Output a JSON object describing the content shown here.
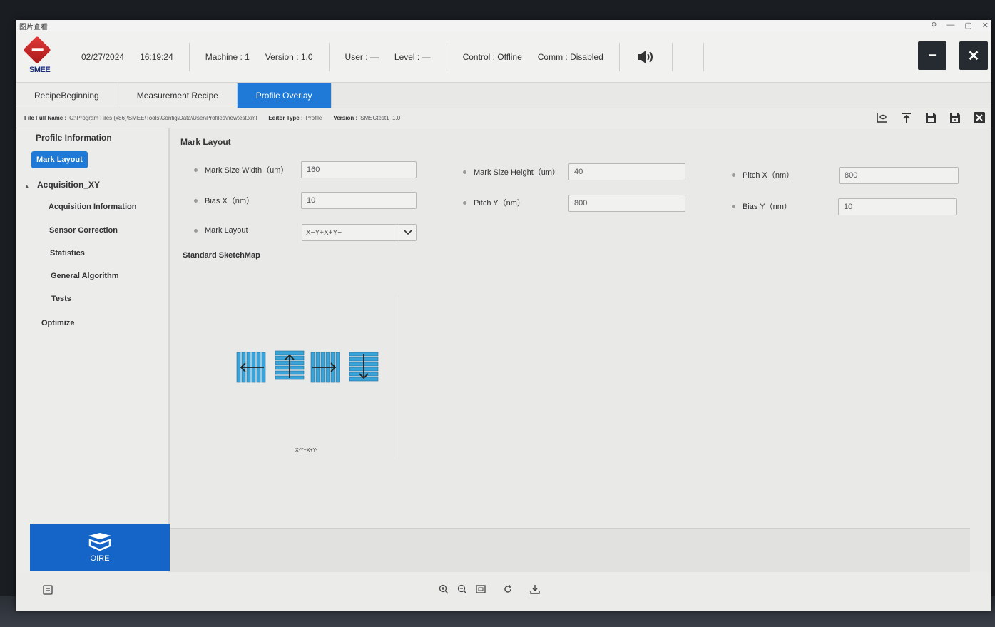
{
  "viewer": {
    "title": "图片查看",
    "controls": [
      "⚲",
      "—",
      "▢",
      "✕"
    ]
  },
  "logo": {
    "text": "SMEE"
  },
  "header": {
    "date": "02/27/2024",
    "time": "16:19:24",
    "machine": "Machine : 1",
    "version": "Version : 1.0",
    "user": "User : —",
    "level": "Level : —",
    "control": "Control : Offline",
    "comm": "Comm : Disabled",
    "minimize": "−",
    "close": "✕"
  },
  "tabs": [
    {
      "label": "RecipeBeginning"
    },
    {
      "label": "Measurement Recipe"
    },
    {
      "label": "Profile Overlay"
    }
  ],
  "filebar": {
    "file_label": "File Full Name :",
    "file_value": "C:\\Program Files (x86)\\SMEE\\Tools\\Config\\Data\\User\\Profiles\\newtest.xml",
    "editor_label": "Editor Type :",
    "editor_value": "Profile",
    "version_label": "Version :",
    "version_value": "SMSCtest1_1.0"
  },
  "sidebar": {
    "items": [
      {
        "label": "Profile Information"
      },
      {
        "label": "Mark Layout"
      },
      {
        "label": "Acquisition_XY"
      },
      {
        "label": "Acquisition Information"
      },
      {
        "label": "Sensor Correction"
      },
      {
        "label": "Statistics"
      },
      {
        "label": "General Algorithm"
      },
      {
        "label": "Tests"
      },
      {
        "label": "Optimize"
      }
    ],
    "oire_label": "OIRE"
  },
  "main": {
    "section_title": "Mark Layout",
    "fields": {
      "mark_size_width": {
        "label": "Mark Size Width（um）",
        "value": "160"
      },
      "mark_size_height": {
        "label": "Mark Size Height（um）",
        "value": "40"
      },
      "pitch_x": {
        "label": "Pitch X（nm）",
        "value": "800"
      },
      "bias_x": {
        "label": "Bias X（nm）",
        "value": "10"
      },
      "pitch_y": {
        "label": "Pitch Y（nm）",
        "value": "800"
      },
      "bias_y": {
        "label": "Bias Y（nm）",
        "value": "10"
      },
      "mark_layout": {
        "label": "Mark Layout",
        "value": "X−Y+X+Y−"
      }
    },
    "sketch_title": "Standard SketchMap",
    "sketch_caption": "X-Y+X+Y-"
  },
  "colors": {
    "accent": "#1e7ad6",
    "oire": "#1565c8",
    "mark": "#3aa3d8"
  }
}
